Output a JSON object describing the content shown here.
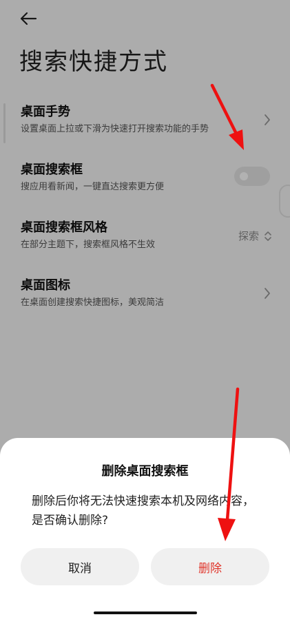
{
  "header": {
    "title": "搜索快捷方式",
    "back_icon": "arrow-left-icon"
  },
  "settings": {
    "items": [
      {
        "title": "桌面手势",
        "subtitle": "设置桌面上拉或下滑为快速打开搜索功能的手势",
        "control": "chevron-right-icon"
      },
      {
        "title": "桌面搜索框",
        "subtitle": "搜应用看新闻，一键直达搜索更方便",
        "control": "toggle",
        "toggle_on": false
      },
      {
        "title": "桌面搜索框风格",
        "subtitle": "在部分主题下，搜索框风格不生效",
        "value": "探索",
        "control": "chevron-updown-icon"
      },
      {
        "title": "桌面图标",
        "subtitle": "在桌面创建搜索快捷图标，美观简洁",
        "control": "chevron-right-icon"
      }
    ]
  },
  "dialog": {
    "title": "删除桌面搜索框",
    "message": "删除后你将无法快速搜索本机及网络内容，是否确认删除?",
    "cancel_label": "取消",
    "delete_label": "删除"
  },
  "colors": {
    "accent_red": "#e0352b",
    "overlay": "rgba(0,0,0,0.30)",
    "annotation_red": "#ee1111"
  }
}
